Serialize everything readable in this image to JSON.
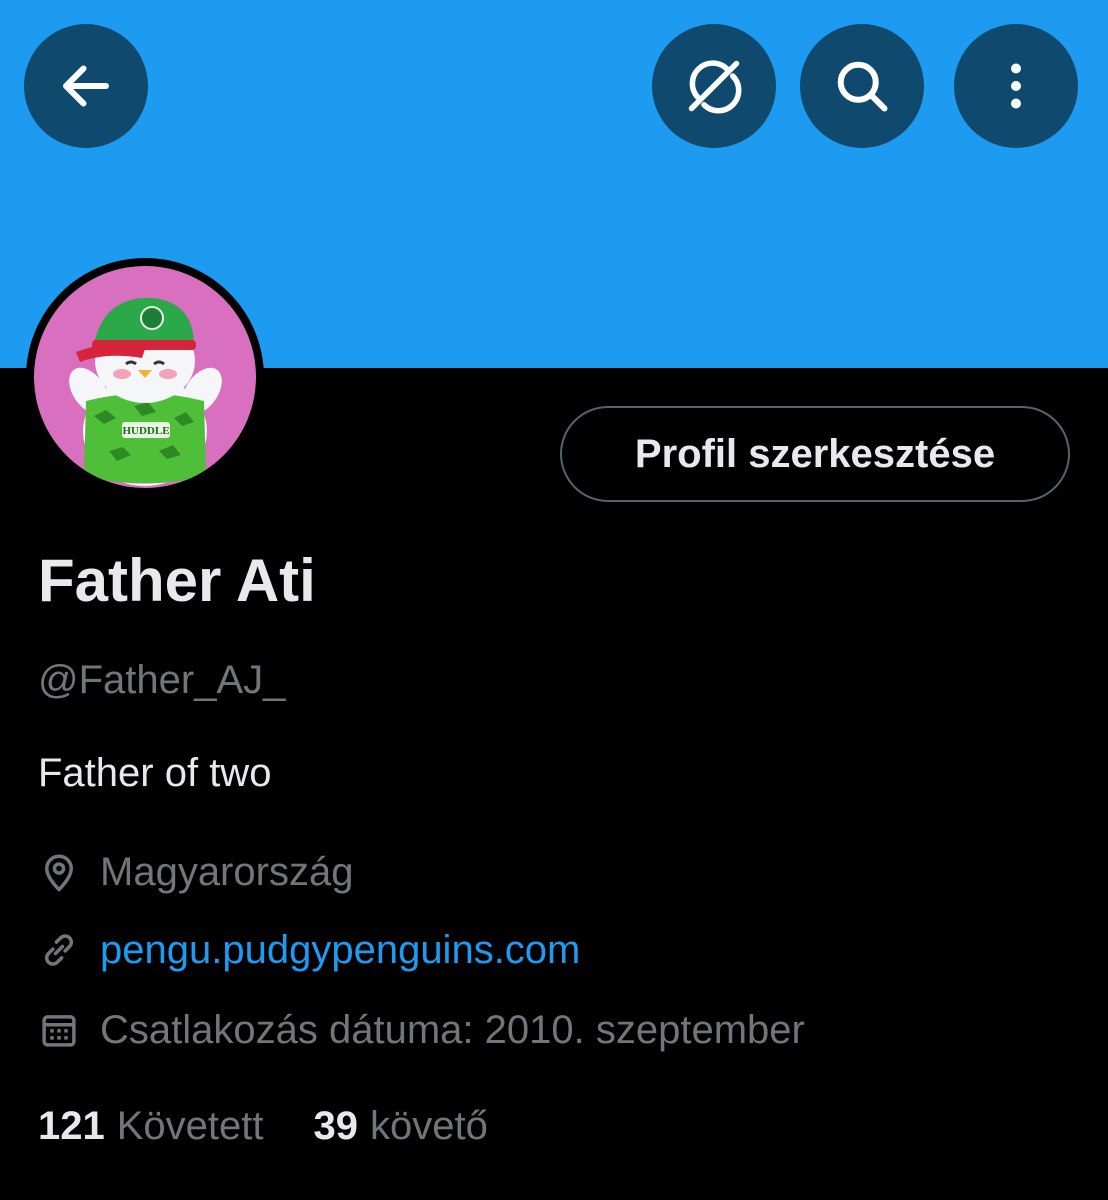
{
  "header": {
    "back_icon": "arrow-left-icon",
    "grok_icon": "grok-icon",
    "search_icon": "search-icon",
    "more_icon": "more-vertical-icon",
    "banner_color": "#1d9bf0"
  },
  "profile": {
    "avatar_icon": "penguin-avatar",
    "edit_button_label": "Profil szerkesztése",
    "display_name": "Father Ati",
    "handle": "@Father_AJ_",
    "bio": "Father of two",
    "location": "Magyarország",
    "website": "pengu.pudgypenguins.com",
    "joined": "Csatlakozás dátuma: 2010. szeptember"
  },
  "stats": {
    "following_count": "121",
    "following_label": "Követett",
    "followers_count": "39",
    "followers_label": "követő"
  },
  "colors": {
    "background": "#000000",
    "accent": "#1d9bf0",
    "text_primary": "#e7e9ea",
    "text_secondary": "#71767b"
  }
}
